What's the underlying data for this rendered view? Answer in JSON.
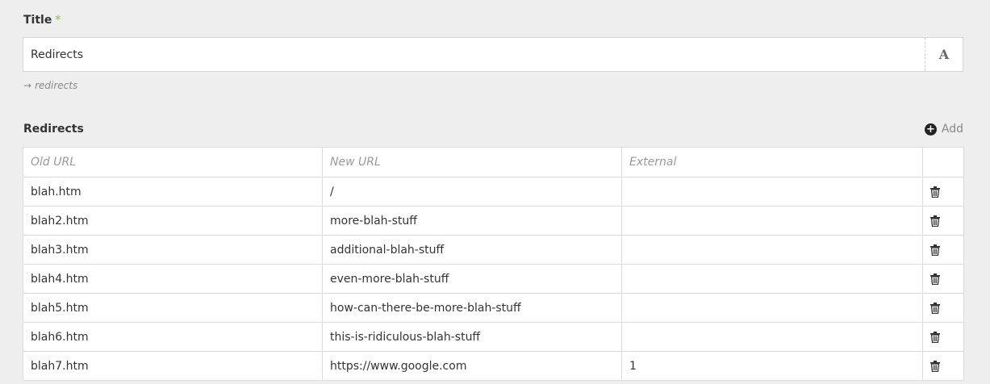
{
  "title_field": {
    "label": "Title",
    "required_marker": "*",
    "value": "Redirects",
    "typography_icon": "A",
    "slug_arrow": "→",
    "slug": "redirects"
  },
  "redirects": {
    "label": "Redirects",
    "add_label": "Add",
    "add_icon": "plus-circle-icon",
    "columns": [
      "Old URL",
      "New URL",
      "External"
    ],
    "rows": [
      {
        "old": "blah.htm",
        "new": "/",
        "external": ""
      },
      {
        "old": "blah2.htm",
        "new": "more-blah-stuff",
        "external": ""
      },
      {
        "old": "blah3.htm",
        "new": "additional-blah-stuff",
        "external": ""
      },
      {
        "old": "blah4.htm",
        "new": "even-more-blah-stuff",
        "external": ""
      },
      {
        "old": "blah5.htm",
        "new": "how-can-there-be-more-blah-stuff",
        "external": ""
      },
      {
        "old": "blah6.htm",
        "new": "this-is-ridiculous-blah-stuff",
        "external": ""
      },
      {
        "old": "blah7.htm",
        "new": "https://www.google.com",
        "external": "1"
      }
    ]
  },
  "colors": {
    "background": "#eeeeee",
    "required": "#8fbf4a",
    "border": "#dcdcdc"
  }
}
